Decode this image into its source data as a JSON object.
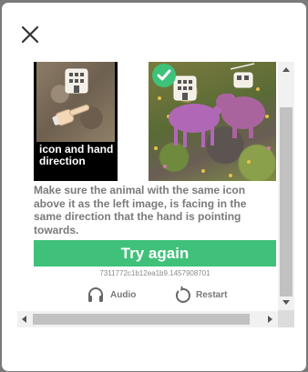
{
  "dialog": {
    "close_icon": "close-icon"
  },
  "challenge": {
    "reference_caption": "icon and hand direction",
    "instruction": "Make sure the animal with the same icon above it as the left image, is facing in the same direction that the hand is pointing towards.",
    "try_again_label": "Try again",
    "session_code": "7311772c1b12ea1b9.1457908701",
    "audio_label": "Audio",
    "restart_label": "Restart"
  },
  "colors": {
    "accent": "#3fc17a",
    "check": "#3ec27a"
  }
}
